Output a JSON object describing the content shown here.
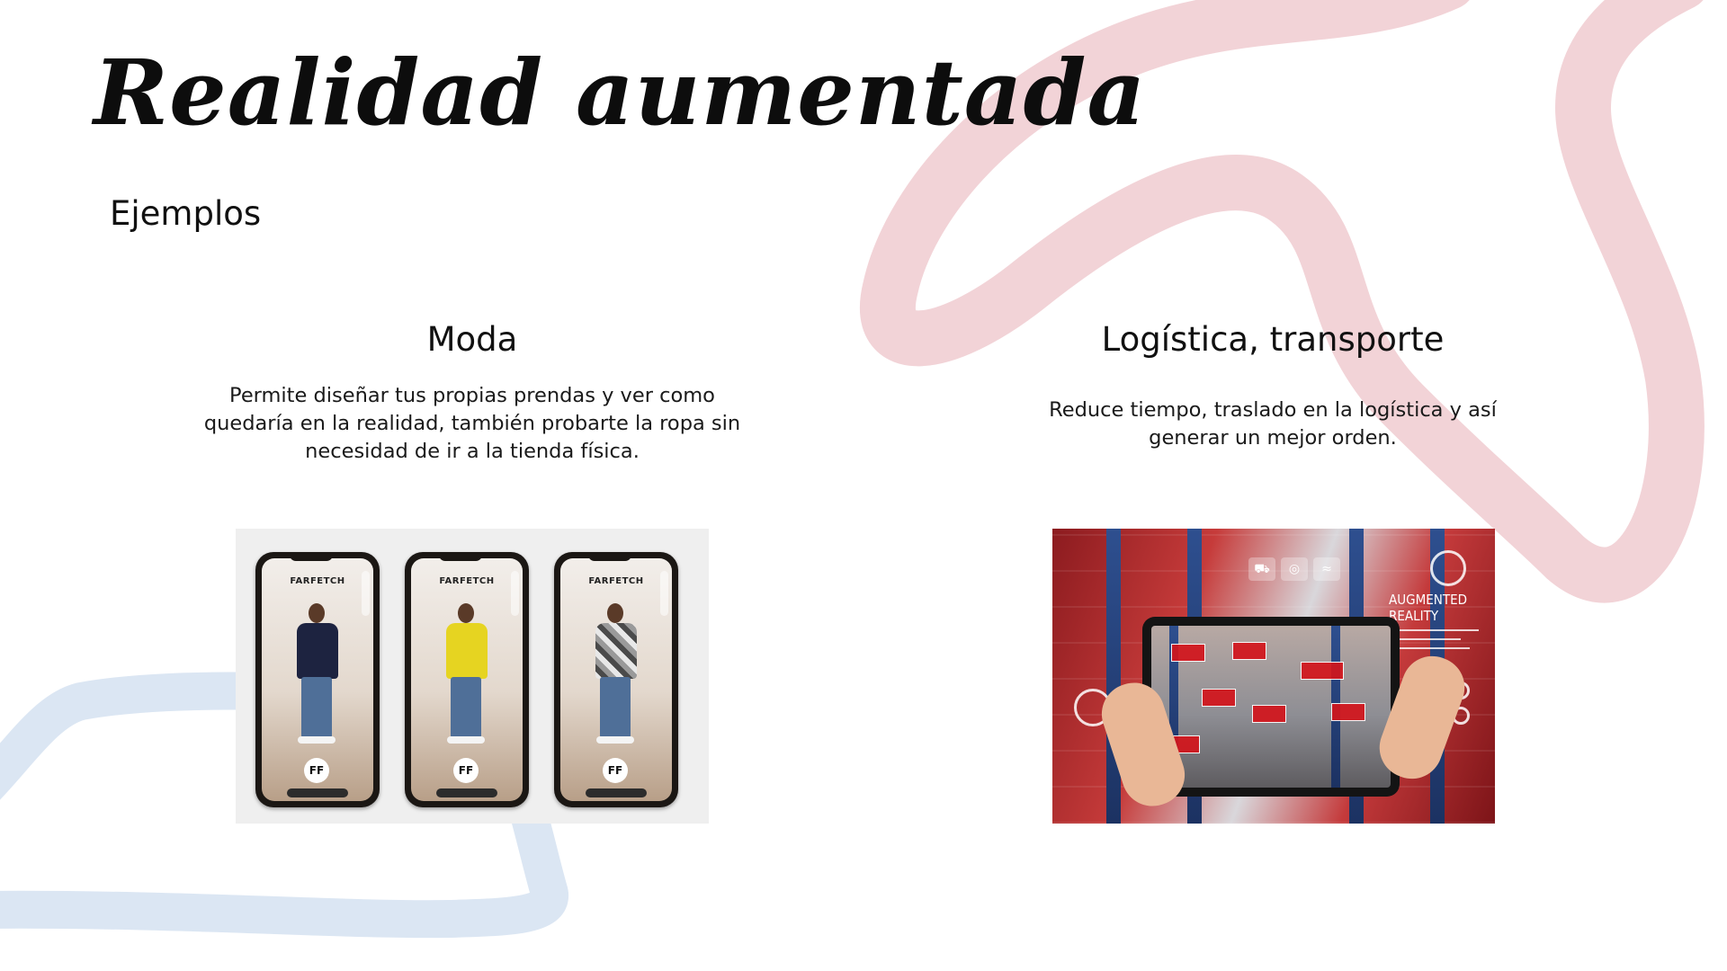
{
  "slide": {
    "title": "Realidad aumentada",
    "subtitle": "Ejemplos"
  },
  "moda": {
    "heading": "Moda",
    "body": "Permite diseñar tus propias prendas y ver como quedaría en la realidad, también probarte la ropa sin necesidad de ir a la tienda física.",
    "phones": [
      {
        "brand": "FARFETCH",
        "shirt_color": "#1d2340"
      },
      {
        "brand": "FARFETCH",
        "shirt_color": "#e6d421"
      },
      {
        "brand": "FARFETCH",
        "shirt_color": "#8d8d8d"
      }
    ],
    "logo_text": "FF"
  },
  "logistica": {
    "heading": "Logística, transporte",
    "body": "Reduce tiempo, traslado en la logística y así generar un mejor orden.",
    "image_label": "AUGMENTED REALITY"
  },
  "decor": {
    "pink": "#f2d3d7",
    "blue": "#dbe6f3"
  }
}
